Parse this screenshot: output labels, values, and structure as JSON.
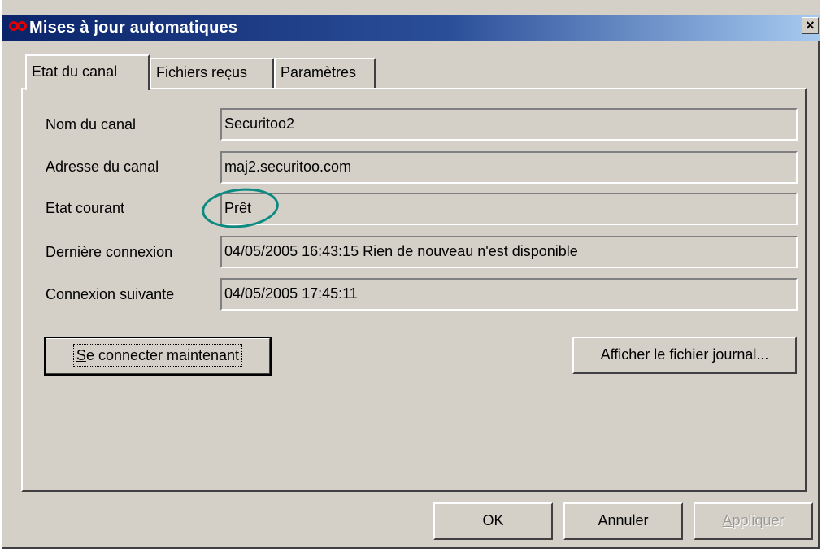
{
  "window": {
    "title": "Mises à jour automatiques",
    "close_glyph": "×",
    "icon": "infinity-logo-icon",
    "accent_color": "#cc0000"
  },
  "tabs": [
    {
      "label": "Etat du canal",
      "active": true
    },
    {
      "label": "Fichiers reçus",
      "active": false
    },
    {
      "label": "Paramètres",
      "active": false
    }
  ],
  "fields": [
    {
      "label": "Nom du canal",
      "value": "Securitoo2"
    },
    {
      "label": "Adresse du canal",
      "value": "maj2.securitoo.com"
    },
    {
      "label": "Etat courant",
      "value": "Prêt"
    },
    {
      "label": "Dernière connexion",
      "value": "04/05/2005 16:43:15  Rien de nouveau n'est disponible"
    },
    {
      "label": "Connexion suivante",
      "value": "04/05/2005 17:45:11"
    }
  ],
  "buttons": {
    "connect_accel": "S",
    "connect_rest": "e connecter maintenant",
    "show_log": "Afficher le fichier journal...",
    "ok": "OK",
    "cancel": "Annuler",
    "apply_accel": "A",
    "apply_rest": "ppliquer"
  }
}
